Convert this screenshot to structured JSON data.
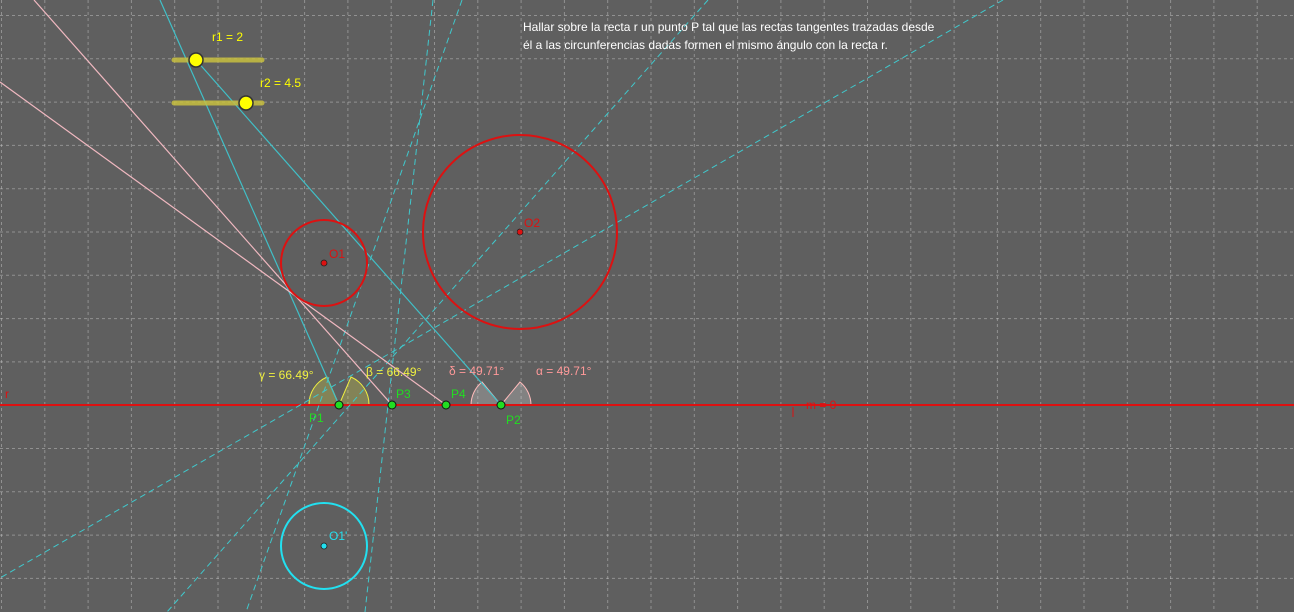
{
  "statement": {
    "line1": "Hallar sobre la recta r un punto P tal que las rectas tangentes trazadas desde",
    "line2": "él a las circunferencias dadas formen el mismo ángulo con la recta r."
  },
  "sliders": {
    "r1": {
      "label": "r1 = 2",
      "value": 2
    },
    "r2": {
      "label": "r2 = 4.5",
      "value": 4.5
    }
  },
  "line_r": {
    "label": "r",
    "equation": "m = 0"
  },
  "circles": {
    "O1": {
      "label": "O1",
      "radius": 2
    },
    "O2": {
      "label": "O2",
      "radius": 4.5
    },
    "O1p": {
      "label": "O1'",
      "radius": 2
    }
  },
  "points": {
    "P1": {
      "label": "P1"
    },
    "P2": {
      "label": "P2"
    },
    "P3": {
      "label": "P3"
    },
    "P4": {
      "label": "P4"
    }
  },
  "angles": {
    "gamma": {
      "label": "γ = 66.49°",
      "value": 66.49
    },
    "beta": {
      "label": "β = 66.49°",
      "value": 66.49
    },
    "delta": {
      "label": "δ = 49.71°",
      "value": 49.71
    },
    "alpha": {
      "label": "α = 49.71°",
      "value": 49.71
    }
  },
  "colors": {
    "background": "#5f5f5f",
    "grid": "#cfcfcf",
    "line_r": "#dd1111",
    "circle": "#dd1111",
    "circle_reflected": "#22e0f0",
    "tangent_solid": "#40c0c8",
    "tangent_dashed": "#40c8cc",
    "tangent_pink": "#f0b8c0",
    "point": "#22dd22",
    "slider": "#ffff00",
    "angle_yellow": "#f0f040",
    "angle_pink": "#ff9999",
    "text": "#ffffff"
  }
}
